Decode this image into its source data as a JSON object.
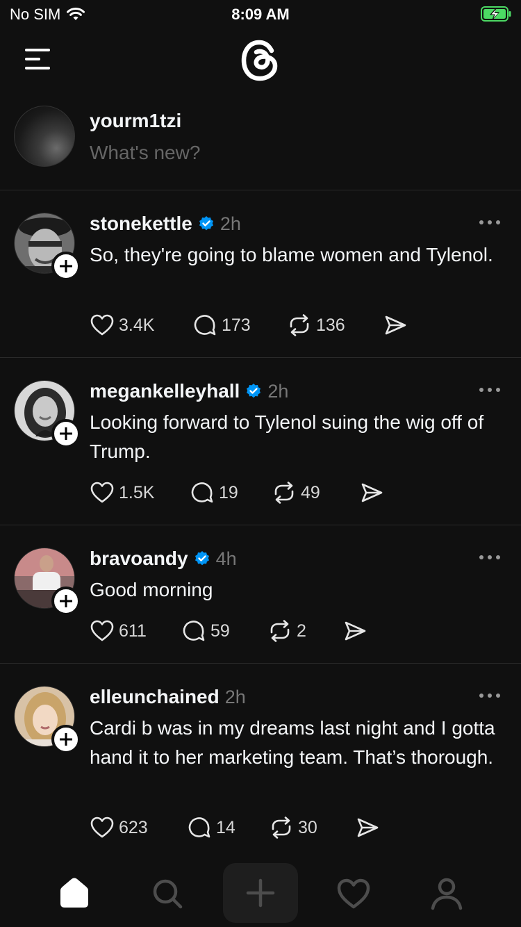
{
  "status": {
    "carrier": "No SIM",
    "time": "8:09 AM"
  },
  "composer": {
    "username": "yourm1tzi",
    "placeholder": "What's new?"
  },
  "posts": [
    {
      "username": "stonekettle",
      "verified": true,
      "time": "2h",
      "text": "So, they're going to blame women and Tylenol.",
      "likes": "3.4K",
      "replies": "173",
      "reposts": "136"
    },
    {
      "username": "megankelleyhall",
      "verified": true,
      "time": "2h",
      "text": "Looking forward to Tylenol suing the wig off of Trump.",
      "likes": "1.5K",
      "replies": "19",
      "reposts": "49"
    },
    {
      "username": "bravoandy",
      "verified": true,
      "time": "4h",
      "text": "Good morning",
      "likes": "611",
      "replies": "59",
      "reposts": "2"
    },
    {
      "username": "elleunchained",
      "verified": false,
      "time": "2h",
      "text": "Cardi b was in my dreams last night and I gotta hand it to her marketing team. That’s thorough.",
      "likes": "623",
      "replies": "14",
      "reposts": "30"
    }
  ],
  "icons": {
    "menu": "menu-icon",
    "logo": "threads-logo-icon",
    "verified": "verified-badge-icon",
    "like": "heart-icon",
    "reply": "comment-icon",
    "repost": "repost-icon",
    "share": "send-icon",
    "home": "home-icon",
    "search": "search-icon",
    "create": "plus-icon",
    "activity": "heart-icon",
    "profile": "profile-icon"
  },
  "colors": {
    "background": "#101010",
    "verified": "#0095f6",
    "text": "#f3f5f7",
    "muted": "#777777"
  }
}
